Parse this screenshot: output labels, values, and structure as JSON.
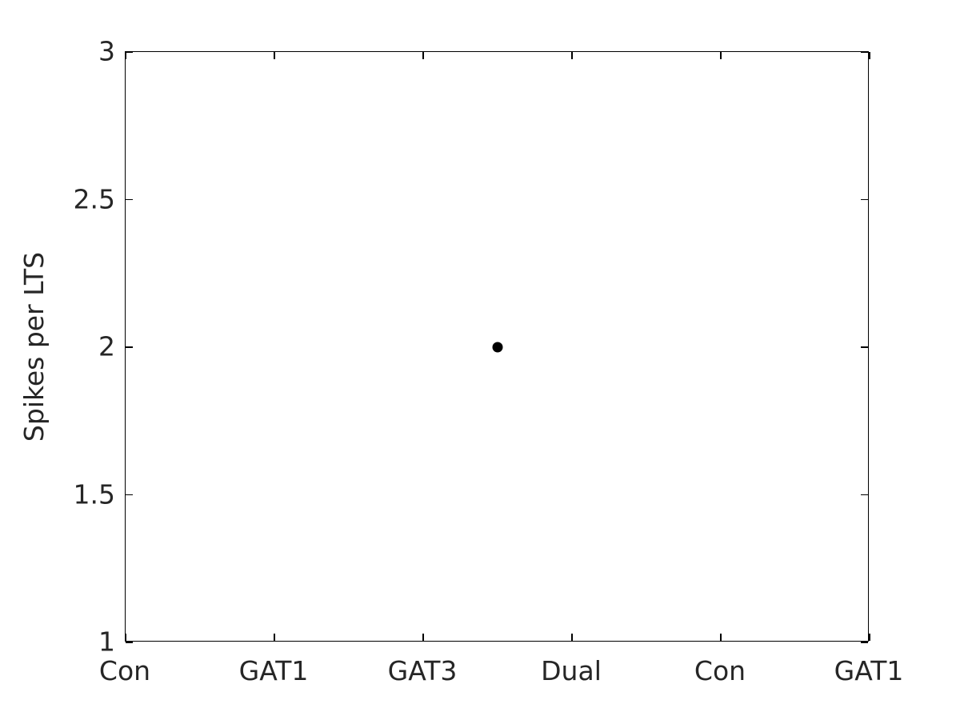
{
  "chart_data": {
    "type": "scatter",
    "title": "",
    "xlabel": "",
    "ylabel": "Spikes per LTS",
    "ylim": [
      1,
      3
    ],
    "yticks": [
      1,
      1.5,
      2,
      2.5,
      3
    ],
    "ytick_labels": [
      "1",
      "1.5",
      "2",
      "2.5",
      "3"
    ],
    "xlim": [
      0,
      5
    ],
    "xticks": [
      0,
      1,
      2,
      3,
      4,
      5
    ],
    "xtick_labels": [
      "Con",
      "GAT1",
      "GAT3",
      "Dual",
      "Con",
      "GAT1"
    ],
    "grid": false,
    "legend": null,
    "marker": {
      "shape": "circle",
      "color": "#000000",
      "size": 13
    },
    "series": [
      {
        "name": "Spikes per LTS",
        "points": [
          {
            "x": 2.5,
            "y": 2.0,
            "label": ""
          }
        ]
      }
    ],
    "axes_style": {
      "spine_color": "#000000",
      "tick_direction": "in",
      "mirrored_ticks": true,
      "text_color": "#262626",
      "background": "#ffffff"
    }
  }
}
